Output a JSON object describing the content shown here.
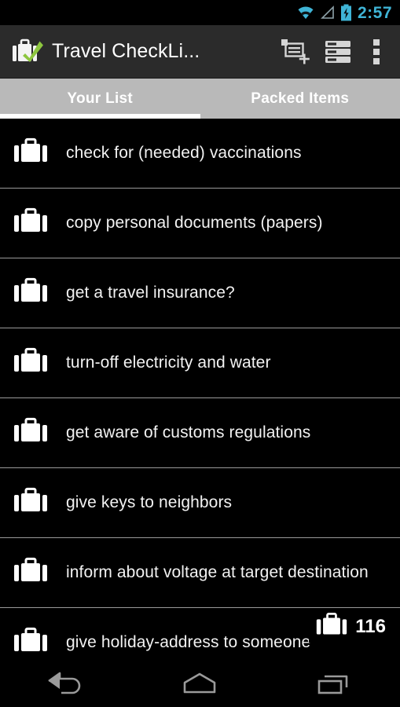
{
  "status_bar": {
    "time": "2:57",
    "icons": [
      "wifi-icon",
      "signal-icon",
      "battery-charging-icon"
    ],
    "time_color": "#3fb4d6"
  },
  "action_bar": {
    "logo": "suitcase-check-logo",
    "title": "Travel CheckLi...",
    "background": "#2b2b2b",
    "actions": [
      {
        "name": "new-item-icon",
        "label": "New item"
      },
      {
        "name": "list-sort-icon",
        "label": "Sort list"
      },
      {
        "name": "overflow-menu-icon",
        "label": "More options"
      }
    ]
  },
  "tabs": {
    "background": "#b9b9b9",
    "active_index": 0,
    "items": [
      {
        "label": "Your List"
      },
      {
        "label": "Packed Items"
      }
    ]
  },
  "list": {
    "item_icon": "suitcase-icon",
    "items": [
      {
        "label": "check for (needed) vaccinations"
      },
      {
        "label": "copy personal documents (papers)"
      },
      {
        "label": "get a travel insurance?"
      },
      {
        "label": "turn-off electricity and water"
      },
      {
        "label": "get aware of customs regulations"
      },
      {
        "label": "give keys to neighbors"
      },
      {
        "label": "inform about voltage at target destination"
      },
      {
        "label": "give holiday-address to someone"
      }
    ]
  },
  "count_badge": {
    "icon": "suitcase-icon",
    "value": "116"
  },
  "nav_bar": {
    "buttons": [
      {
        "name": "back-button",
        "label": "Back"
      },
      {
        "name": "home-button",
        "label": "Home"
      },
      {
        "name": "recents-button",
        "label": "Recent apps"
      }
    ]
  }
}
